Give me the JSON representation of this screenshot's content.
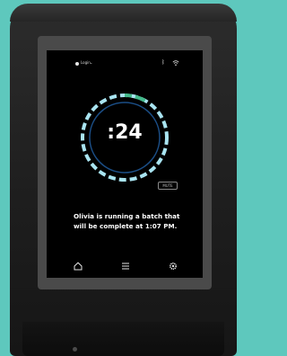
{
  "status_bar": {
    "account_label": "Login",
    "icons": [
      "logo-icon",
      "chevron-down-icon",
      "bluetooth-icon",
      "wifi-icon"
    ]
  },
  "timer": {
    "display": ":24",
    "progress_fraction": 0.08
  },
  "mute_button": {
    "label": "MUTE"
  },
  "message": {
    "text": "Olivia is running a batch that will be complete at 1:07 PM."
  },
  "bottom_nav": {
    "items": [
      "home-icon",
      "menu-icon",
      "settings-gear-icon"
    ]
  },
  "colors": {
    "ring_dash": "#a9e4f1",
    "ring_progress": "#43b98a",
    "inner_ring": "#1b4e86",
    "background": "#5ec8bd"
  }
}
